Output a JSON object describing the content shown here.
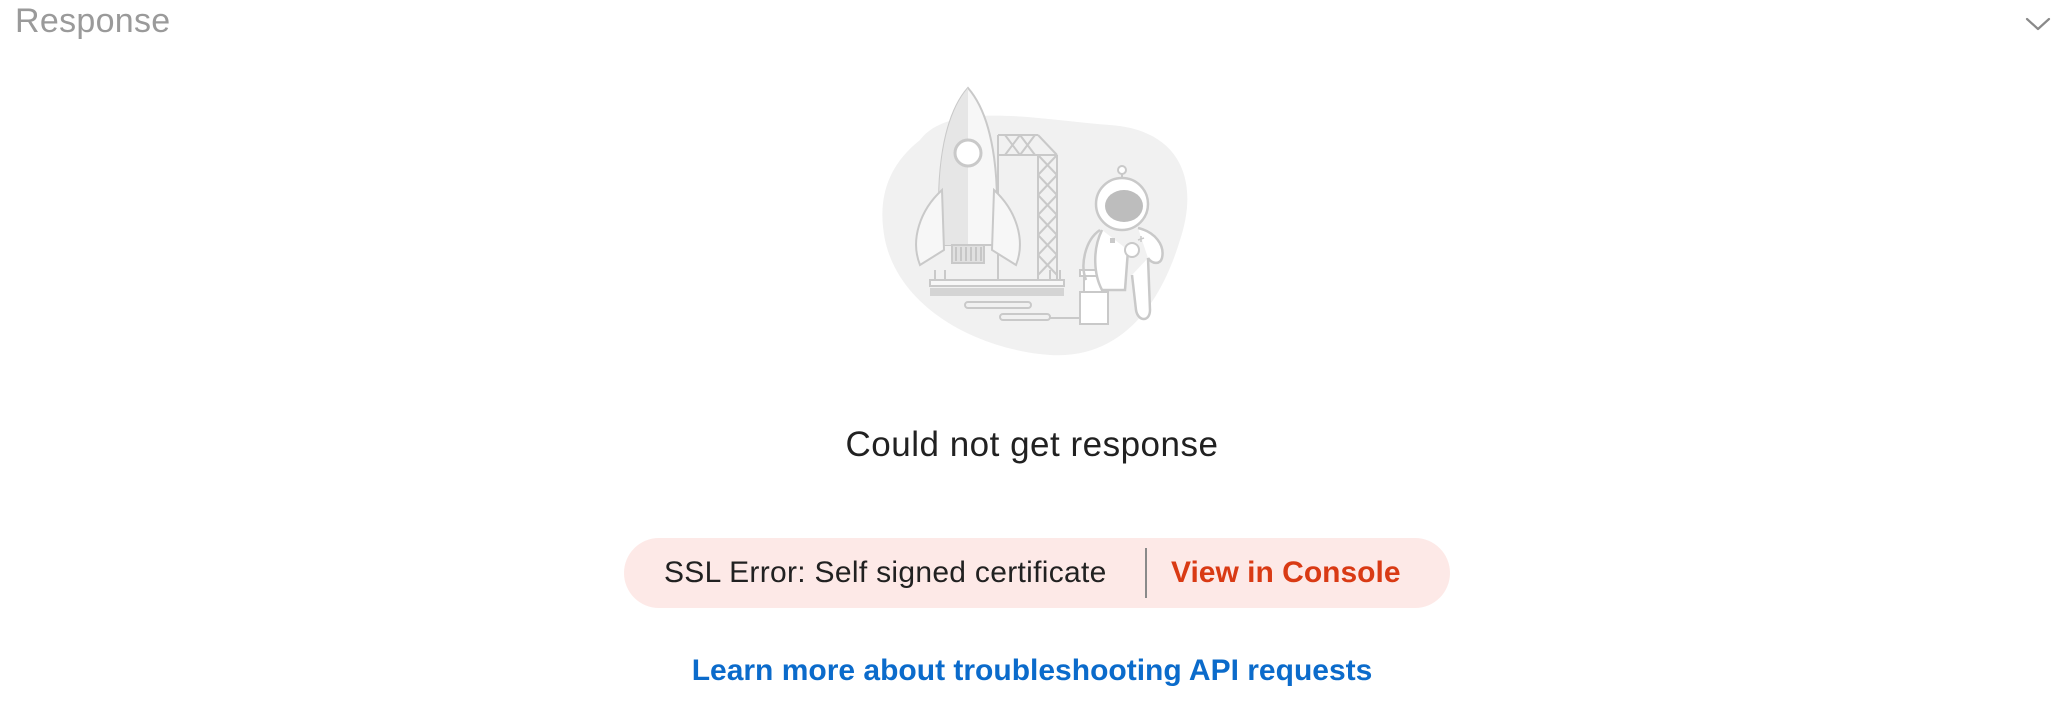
{
  "header": {
    "title": "Response",
    "collapse_icon": "chevron-down-icon"
  },
  "illustration": {
    "icon": "rocket-launch-astronaut-illustration"
  },
  "empty_state": {
    "message": "Could not get response"
  },
  "error": {
    "text": "SSL Error: Self signed certificate",
    "console_link": "View in Console",
    "background_color": "#fde9e7",
    "accent_color": "#d93a14"
  },
  "help": {
    "link_text": "Learn more about troubleshooting API requests",
    "link_color": "#0b6bcb"
  }
}
